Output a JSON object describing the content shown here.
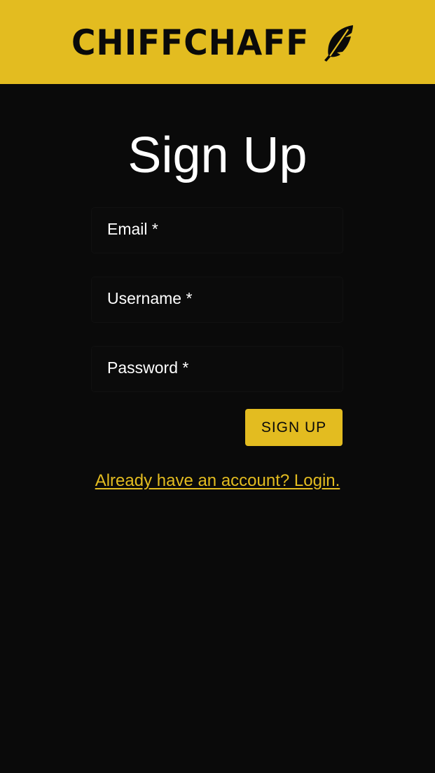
{
  "header": {
    "brand": "CHIFFCHAFF",
    "logo_icon": "feather-icon"
  },
  "page": {
    "title": "Sign Up"
  },
  "form": {
    "email_label": "Email *",
    "username_label": "Username *",
    "password_label": "Password *",
    "email_value": "",
    "username_value": "",
    "password_value": "",
    "submit_label": "SIGN UP"
  },
  "footer": {
    "login_link": "Already have an account? Login."
  },
  "colors": {
    "accent": "#e3bc20",
    "background": "#0a0a0a",
    "text": "#ffffff"
  }
}
